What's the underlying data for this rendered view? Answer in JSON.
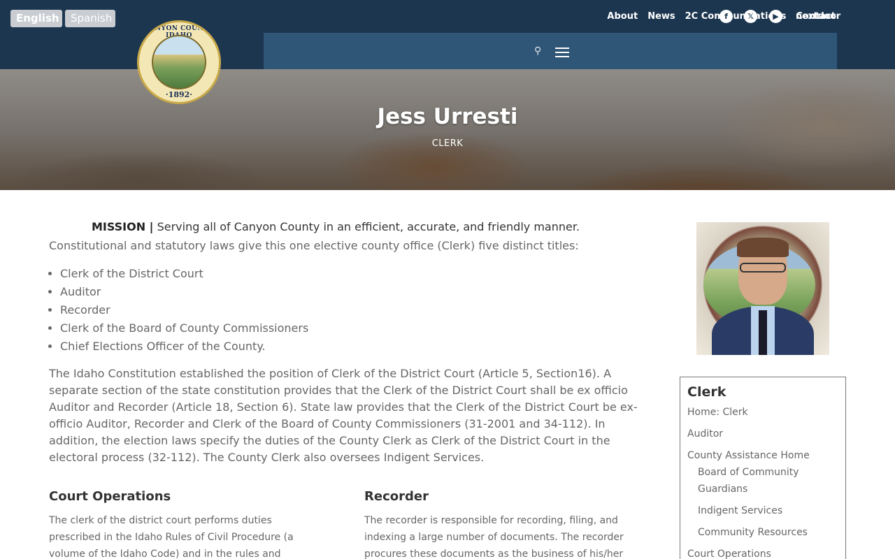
{
  "language": {
    "english": "English",
    "spanish": "Spanish"
  },
  "topnav": [
    {
      "label": "About"
    },
    {
      "label": "News"
    },
    {
      "label": "2C Communications"
    },
    {
      "label": "Contact"
    }
  ],
  "social": {
    "facebook": "f",
    "x": "𝕏",
    "youtube": "▶",
    "nextdoor": "nextdoor"
  },
  "seal": {
    "top_text": "CANYON COUNTY IDAHO",
    "year": "·1892·"
  },
  "hero": {
    "title": "Jess Urresti",
    "subtitle": "CLERK"
  },
  "mission": {
    "label": "MISSION |",
    "text": " Serving all of Canyon County in an efficient, accurate, and friendly manner."
  },
  "intro": "Constitutional and statutory laws give this one elective county office (Clerk) five distinct titles:",
  "titles": [
    "Clerk of the District Court",
    "Auditor",
    "Recorder",
    "Clerk of the Board of County Commissioners",
    "Chief Elections Officer of the County."
  ],
  "paragraph": "The Idaho Constitution established the position of Clerk of the District Court (Article 5, Section16). A separate section of the state constitution provides that the Clerk of the District Court shall be ex officio Auditor and Recorder (Article 18, Section 6). State law provides that the Clerk of the District Court be ex-officio Auditor, Recorder and Clerk of the Board of County Commissioners (31-2001 and 34-112). In addition, the election laws specify the duties of the County Clerk as Clerk of the District Court in the electoral process (32-112). The County Clerk also oversees Indigent Services.",
  "court_operations": {
    "heading": "Court Operations",
    "text": "The clerk of the district court performs duties prescribed in the Idaho Rules of Civil Procedure (a volume of the Idaho Code) and in the rules and practices of the court"
  },
  "recorder": {
    "heading": "Recorder",
    "text": "The recorder is responsible for recording, filing, and indexing a large number of documents. The recorder procures these documents as the business of his/her"
  },
  "sidebar": {
    "heading": "Clerk",
    "links": [
      {
        "label": "Home: Clerk",
        "sub": false
      },
      {
        "label": "Auditor",
        "sub": false
      },
      {
        "label": "County Assistance Home",
        "sub": false
      },
      {
        "label": "Board of Community Guardians",
        "sub": true
      },
      {
        "label": "Indigent Services",
        "sub": true
      },
      {
        "label": "Community Resources",
        "sub": true
      },
      {
        "label": "Court Operations",
        "sub": false
      }
    ]
  }
}
